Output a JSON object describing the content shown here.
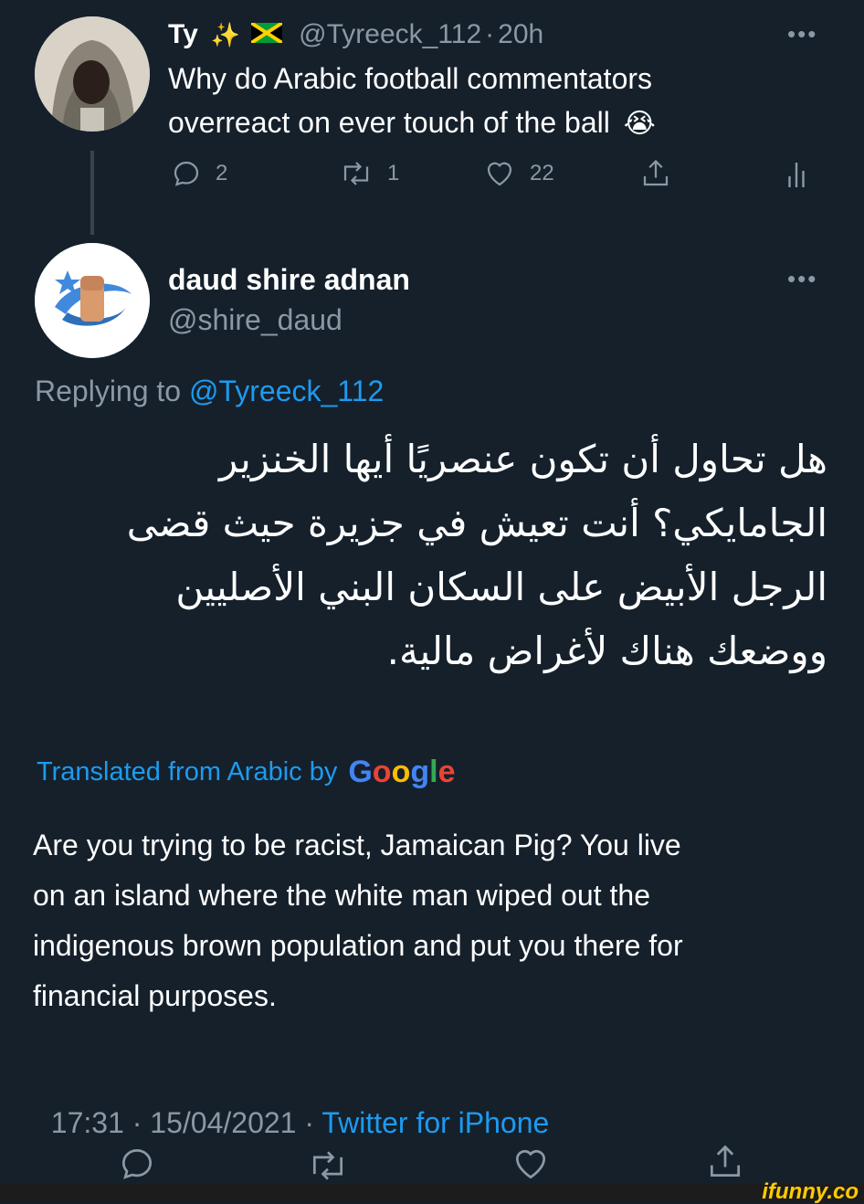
{
  "original_tweet": {
    "display_name": "Ty",
    "name_emoji": "✨",
    "handle": "@Tyreeck_112",
    "separator": "·",
    "time_ago": "20h",
    "text_line1": "Why do Arabic football commentators",
    "text_line2": "overreact on ever touch of the ball",
    "text_emoji": "😭",
    "actions": {
      "replies": "2",
      "retweets": "1",
      "likes": "22"
    },
    "more": "•••"
  },
  "reply_tweet": {
    "display_name": "daud shire adnan",
    "handle": "@shire_daud",
    "more": "•••",
    "replying_to_label": "Replying to",
    "replying_to_handle": "@Tyreeck_112",
    "arabic_lines": [
      "هل تحاول أن تكون عنصريًا أيها الخنزير",
      "الجامايكي؟ أنت تعيش في جزيرة حيث قضى",
      "الرجل الأبيض على السكان البني الأصليين",
      "ووضعك هناك لأغراض مالية."
    ],
    "translated_label": "Translated from Arabic by",
    "google_letters": [
      "G",
      "o",
      "o",
      "g",
      "l",
      "e"
    ],
    "translation_lines": [
      "Are you trying to be racist, Jamaican Pig? You live",
      "on an island where the white man wiped out the",
      "indigenous brown population and put you there for",
      "financial purposes."
    ],
    "timestamp": "17:31 · 15/04/2021 · ",
    "source": "Twitter for iPhone"
  },
  "watermark": "ifunny.co",
  "colors": {
    "background": "#15202b",
    "accent": "#1d9bf0",
    "muted": "#8b98a5",
    "google": [
      "#4285f4",
      "#ea4335",
      "#fbbc05",
      "#4285f4",
      "#34a853",
      "#ea4335"
    ]
  }
}
